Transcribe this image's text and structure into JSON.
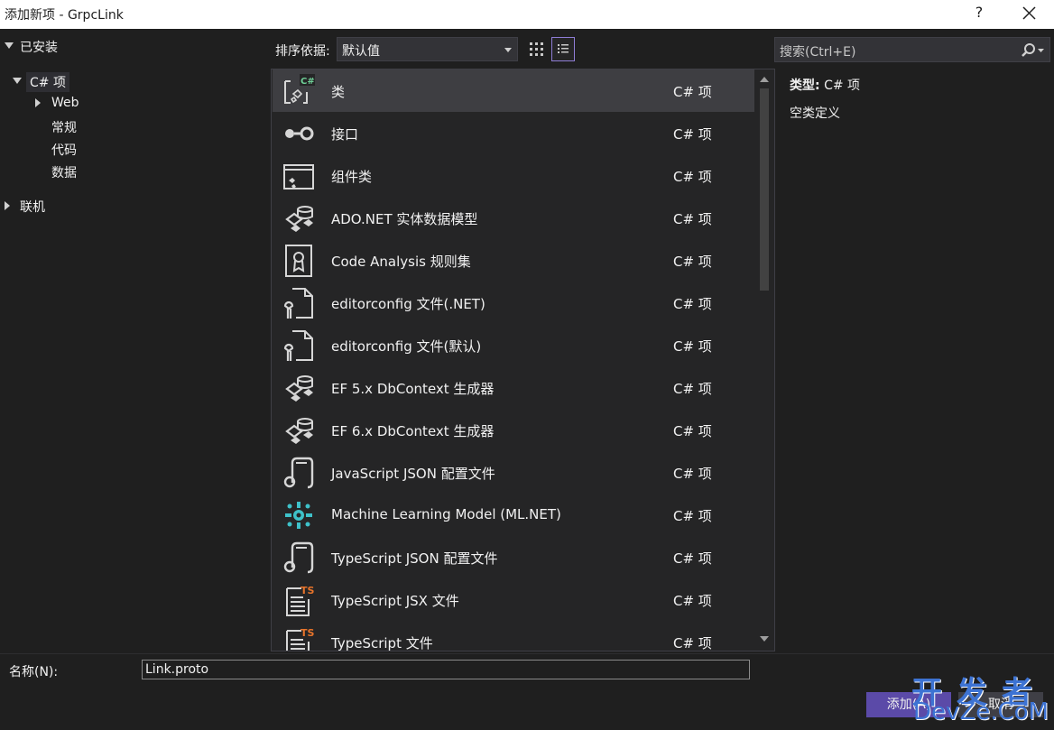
{
  "window": {
    "title": "添加新项 - GrpcLink",
    "help_label": "?",
    "close_icon": "close-icon"
  },
  "sidebar": {
    "installed_label": "已安装",
    "csharp_label": "C# 项",
    "web_label": "Web",
    "general_label": "常规",
    "code_label": "代码",
    "data_label": "数据",
    "online_label": "联机"
  },
  "toolbar": {
    "sort_label": "排序依据:",
    "sort_value": "默认值",
    "grid_view_icon": "grid-view-icon",
    "list_view_icon": "list-view-icon",
    "search_placeholder": "搜索(Ctrl+E)",
    "search_icon": "search-icon"
  },
  "items": [
    {
      "name": "类",
      "type": "C# 项",
      "icon": "class-icon"
    },
    {
      "name": "接口",
      "type": "C# 项",
      "icon": "interface-icon"
    },
    {
      "name": "组件类",
      "type": "C# 项",
      "icon": "component-class-icon"
    },
    {
      "name": "ADO.NET 实体数据模型",
      "type": "C# 项",
      "icon": "entity-model-icon"
    },
    {
      "name": "Code Analysis 规则集",
      "type": "C# 项",
      "icon": "ruleset-icon"
    },
    {
      "name": "editorconfig 文件(.NET)",
      "type": "C# 项",
      "icon": "editorconfig-icon"
    },
    {
      "name": "editorconfig 文件(默认)",
      "type": "C# 项",
      "icon": "editorconfig-icon"
    },
    {
      "name": "EF 5.x DbContext 生成器",
      "type": "C# 项",
      "icon": "entity-model-icon"
    },
    {
      "name": "EF 6.x DbContext 生成器",
      "type": "C# 项",
      "icon": "entity-model-icon"
    },
    {
      "name": "JavaScript JSON 配置文件",
      "type": "C# 项",
      "icon": "json-config-icon"
    },
    {
      "name": "Machine Learning Model (ML.NET)",
      "type": "C# 项",
      "icon": "ml-gear-icon"
    },
    {
      "name": "TypeScript JSON 配置文件",
      "type": "C# 项",
      "icon": "json-config-icon"
    },
    {
      "name": "TypeScript JSX 文件",
      "type": "C# 项",
      "icon": "typescript-file-icon"
    },
    {
      "name": "TypeScript 文件",
      "type": "C# 项",
      "icon": "typescript-file-icon"
    }
  ],
  "selected_index": 0,
  "details": {
    "type_label": "类型:",
    "type_value": "C# 项",
    "description": "空类定义"
  },
  "footer": {
    "name_label": "名称(N):",
    "name_value": "Link.proto",
    "add_label": "添加(A)",
    "cancel_label": "取消"
  },
  "watermark": {
    "line1": "开发者",
    "line2": "DevZe.CoM"
  },
  "colors": {
    "background": "#1f1f1f",
    "list_background": "#252526",
    "selected_row": "#3e3e42",
    "accent": "#5b4aa8",
    "active_view_border": "#8f7dd6",
    "csharp_badge": "#6fcf97",
    "ts_badge": "#e8742b",
    "ml_cyan": "#3ec1c9"
  }
}
